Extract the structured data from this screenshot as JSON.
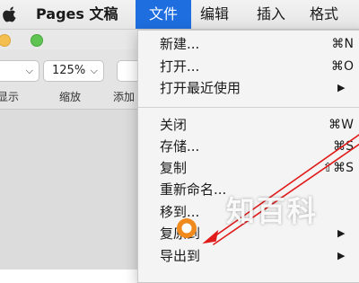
{
  "menubar": {
    "app_name": "Pages 文稿",
    "menus": [
      "文件",
      "编辑",
      "插入",
      "格式"
    ],
    "active_menu": "文件",
    "highlight_color": "#1e6ee0"
  },
  "toolbar": {
    "view_label": "显示",
    "zoom_value": "125%",
    "zoom_label": "缩放",
    "add_label": "添加"
  },
  "file_menu": {
    "items": [
      {
        "label": "新建...",
        "shortcut": "⌘N"
      },
      {
        "label": "打开...",
        "shortcut": "⌘O"
      },
      {
        "label": "打开最近使用",
        "submenu": "▶"
      },
      {
        "label": "关闭",
        "shortcut": "⌘W"
      },
      {
        "label": "存储...",
        "shortcut": "⌘S"
      },
      {
        "label": "复制",
        "shortcut": "⇧⌘S"
      },
      {
        "label": "重新命名..."
      },
      {
        "label": "移到..."
      },
      {
        "label": "复原到",
        "submenu": "▶"
      },
      {
        "label": "导出到",
        "submenu": "▶"
      }
    ]
  },
  "annotation": {
    "arrow_color": "#e01b1b",
    "circle_color": "#f08a1c"
  },
  "watermark": {
    "text": "知百科"
  }
}
